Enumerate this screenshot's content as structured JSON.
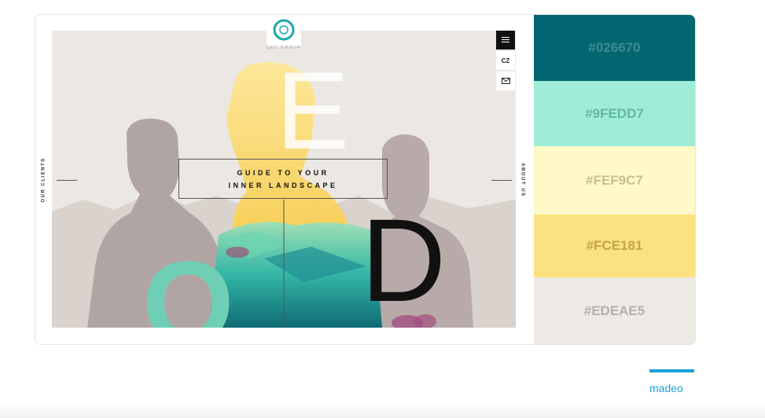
{
  "preview": {
    "logo_text": "QED GROUP",
    "lang_label": "CZ",
    "left_label": "OUR CLIENTS",
    "right_label": "ABOUT US",
    "headline_line1": "GUIDE TO YOUR",
    "headline_line2": "INNER LANDSCAPE",
    "letters": {
      "e": "E",
      "d": "D",
      "q": "Q"
    },
    "icons": [
      "menu-icon",
      "mail-icon",
      "arrow-left-icon",
      "arrow-right-icon"
    ]
  },
  "palette": [
    {
      "label": "#026670",
      "bg": "#026670",
      "fg": "#3f8a92"
    },
    {
      "label": "#9FEDD7",
      "bg": "#9FEDD7",
      "fg": "#62b9a2"
    },
    {
      "label": "#FEF9C7",
      "bg": "#FEF9C7",
      "fg": "#c4bf90"
    },
    {
      "label": "#FCE181",
      "bg": "#FCE181",
      "fg": "#c1a548"
    },
    {
      "label": "#EDEAE5",
      "bg": "#EDEAE5",
      "fg": "#b4b1ac"
    }
  ],
  "author": {
    "name": "madeo",
    "accent": "#1aa0d8"
  }
}
